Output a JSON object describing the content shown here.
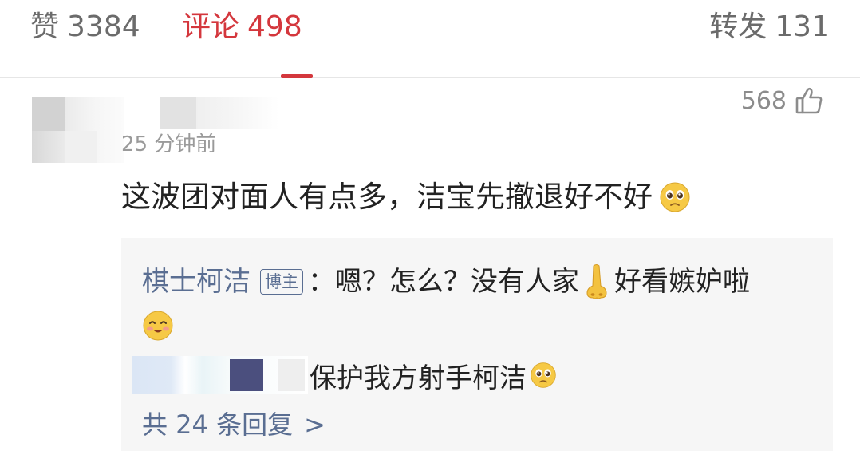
{
  "tabs": {
    "likes": {
      "label": "赞",
      "count": "3384"
    },
    "comments": {
      "label": "评论",
      "count": "498"
    },
    "reposts": {
      "label": "转发",
      "count": "131"
    }
  },
  "comment": {
    "timestamp": "25 分钟前",
    "like_count": "568",
    "text": "这波团对面人有点多，洁宝先撤退好不好",
    "emoji": "pleading-face-icon"
  },
  "replies": {
    "author_reply": {
      "author": "棋士柯洁",
      "badge": "博主",
      "text_part1": "：嗯？怎么？没有人家",
      "text_part2": "好看嫉妒啦",
      "emojis": [
        "nose-icon",
        "smiling-blush-icon"
      ]
    },
    "user_reply": {
      "text": "保护我方射手柯洁",
      "emoji": "pleading-face-icon"
    },
    "more_label": "共 24 条回复",
    "more_chevron": ">"
  },
  "colors": {
    "accent_red": "#d4373d",
    "link_blue": "#5a6e92",
    "muted_gray": "#9a9a9a"
  }
}
